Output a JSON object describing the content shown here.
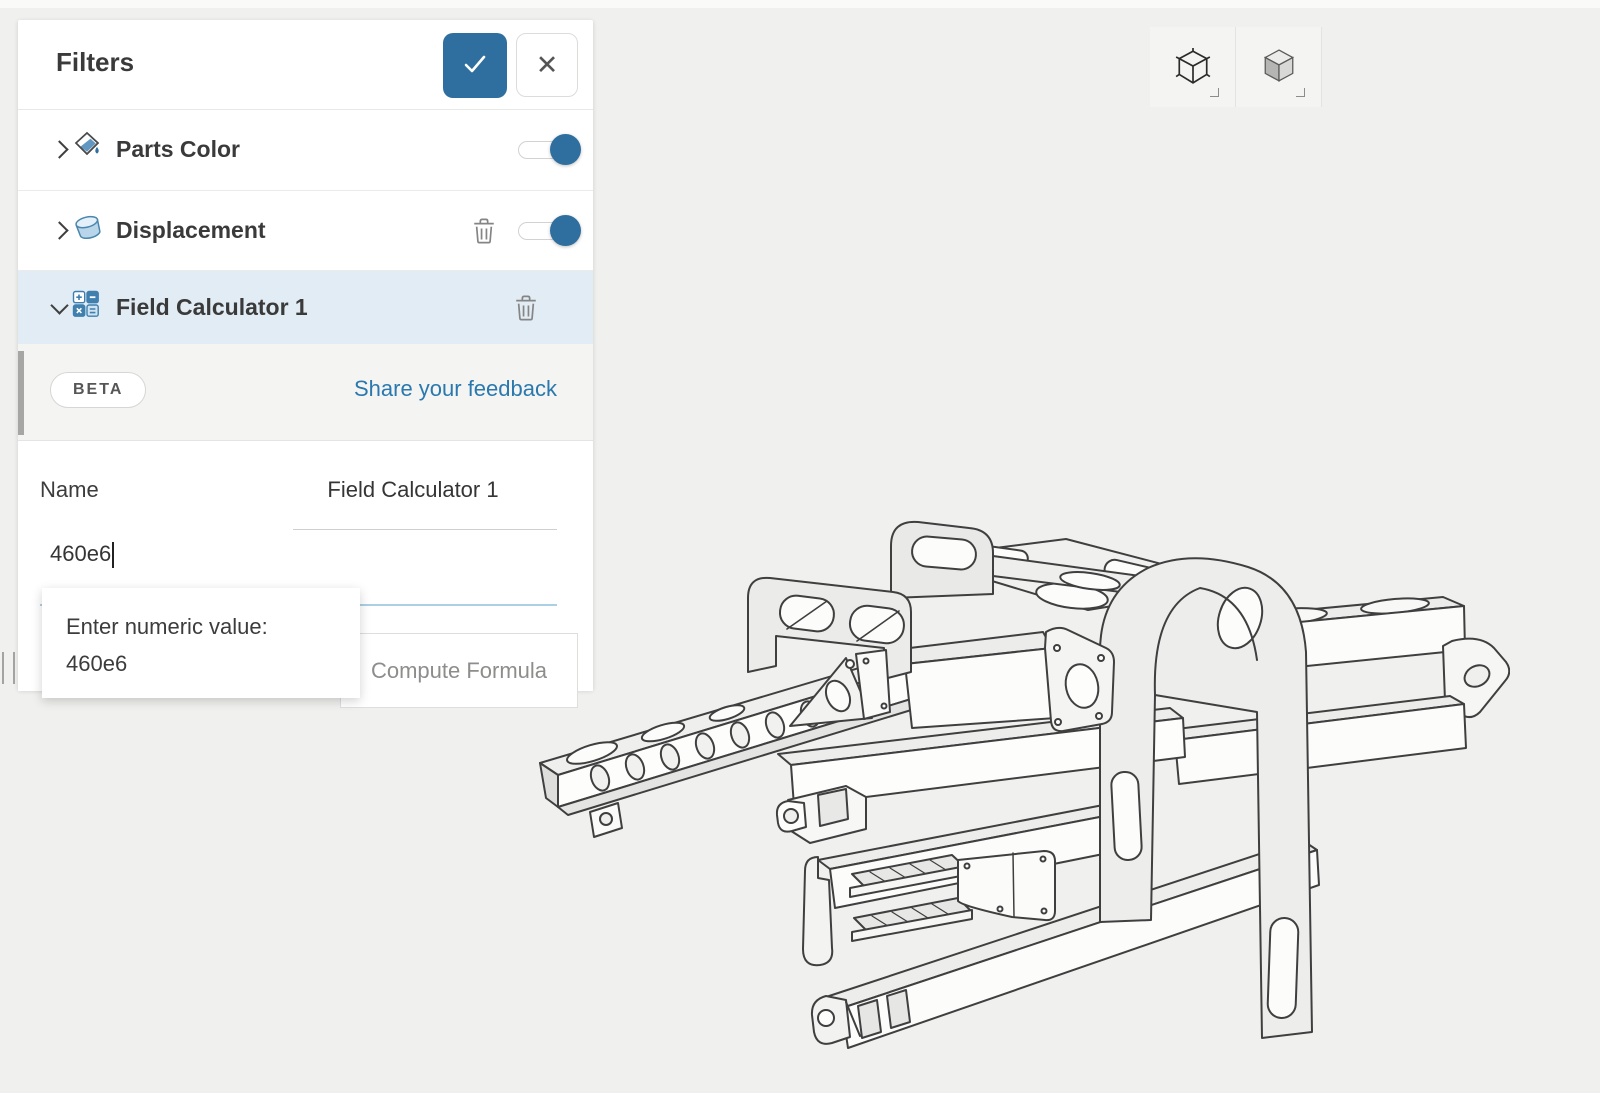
{
  "filters_panel": {
    "title": "Filters",
    "close_glyph": "✕",
    "rows": [
      {
        "label": "Parts Color",
        "icon": "paint-bucket",
        "expanded": false,
        "enabled": true,
        "deletable": false
      },
      {
        "label": "Displacement",
        "icon": "cylinder",
        "expanded": false,
        "enabled": true,
        "deletable": true
      },
      {
        "label": "Field Calculator 1",
        "icon": "calculator",
        "expanded": true,
        "deletable": true,
        "selected": true
      }
    ],
    "beta_badge": "BETA",
    "feedback_link": "Share your feedback",
    "form": {
      "name_label": "Name",
      "name_value": "Field Calculator 1",
      "formula_value": "460e6",
      "compute_button": "Compute Formula"
    },
    "tooltip": {
      "line1": "Enter numeric value:",
      "line2": "460e6"
    }
  },
  "viewport_toolbar": {
    "buttons": [
      {
        "name": "wireframe-view"
      },
      {
        "name": "shaded-view"
      }
    ]
  },
  "colors": {
    "accent_blue": "#2e6f9f",
    "link_blue": "#2a78ad",
    "selected_row_bg": "#e2ecf4",
    "beta_section_bg": "#f4f4f3",
    "page_bg": "#f0f0ee"
  }
}
